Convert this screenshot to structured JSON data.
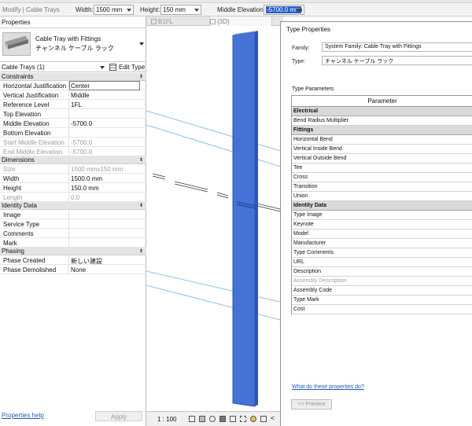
{
  "options_bar": {
    "mode": "Modify | Cable Trays",
    "width_label": "Width:",
    "width_value": "1500 mm",
    "height_label": "Height:",
    "height_value": "150 mm",
    "elevation_label": "Middle Elevation:",
    "elevation_value": "-5700.0 mm"
  },
  "properties": {
    "title": "Properties",
    "family": "Cable Tray with Fittings",
    "type": "チャンネル ケーブル ラック",
    "category": "Cable Trays (1)",
    "edit_type": "Edit Type",
    "groups": [
      {
        "name": "Constraints",
        "rows": [
          {
            "name": "Horizontal Justification",
            "value": "Center",
            "state": "edit"
          },
          {
            "name": "Vertical Justification",
            "value": "Middle",
            "state": ""
          },
          {
            "name": "Reference Level",
            "value": "1FL",
            "state": ""
          },
          {
            "name": "Top Elevation",
            "value": "",
            "state": ""
          },
          {
            "name": "Middle Elevation",
            "value": "-5700.0",
            "state": ""
          },
          {
            "name": "Bottom Elevation",
            "value": "",
            "state": ""
          },
          {
            "name": "Start Middle Elevation",
            "value": "-5700.0",
            "state": "dis"
          },
          {
            "name": "End Middle Elevation",
            "value": "-5700.0",
            "state": "dis"
          }
        ]
      },
      {
        "name": "Dimensions",
        "rows": [
          {
            "name": "Size",
            "value": "1500 mmx150 mm",
            "state": "dis"
          },
          {
            "name": "Width",
            "value": "1500.0 mm",
            "state": ""
          },
          {
            "name": "Height",
            "value": "150.0 mm",
            "state": ""
          },
          {
            "name": "Length",
            "value": "0.0",
            "state": "dis"
          }
        ]
      },
      {
        "name": "Identity Data",
        "rows": [
          {
            "name": "Image",
            "value": "",
            "state": ""
          },
          {
            "name": "Service Type",
            "value": "",
            "state": ""
          },
          {
            "name": "Comments",
            "value": "",
            "state": ""
          },
          {
            "name": "Mark",
            "value": "",
            "state": ""
          }
        ]
      },
      {
        "name": "Phasing",
        "rows": [
          {
            "name": "Phase Created",
            "value": "新しい建設",
            "state": ""
          },
          {
            "name": "Phase Demolished",
            "value": "None",
            "state": ""
          }
        ]
      }
    ],
    "help_link": "Properties help",
    "apply": "Apply"
  },
  "tabs": [
    {
      "label": "B1FL"
    },
    {
      "label": "{3D}"
    }
  ],
  "view_control": {
    "scale": "1 : 100"
  },
  "dialog": {
    "title": "Type Properties",
    "family_label": "Family:",
    "family_value": "System Family: Cable Tray with Fittings",
    "type_label": "Type:",
    "type_value": "チャンネル ケーブル ラック",
    "type_parameters": "Type Parameters",
    "column_header": "Parameter",
    "groups": [
      {
        "name": "Electrical",
        "rows": [
          {
            "name": "Bend Radius Multiplier",
            "state": ""
          }
        ]
      },
      {
        "name": "Fittings",
        "rows": [
          {
            "name": "Horizontal Bend",
            "state": ""
          },
          {
            "name": "Vertical Inside Bend",
            "state": ""
          },
          {
            "name": "Vertical Outside Bend",
            "state": ""
          },
          {
            "name": "Tee",
            "state": ""
          },
          {
            "name": "Cross",
            "state": ""
          },
          {
            "name": "Transition",
            "state": ""
          },
          {
            "name": "Union",
            "state": ""
          }
        ]
      },
      {
        "name": "Identity Data",
        "rows": [
          {
            "name": "Type Image",
            "state": ""
          },
          {
            "name": "Keynote",
            "state": ""
          },
          {
            "name": "Model",
            "state": ""
          },
          {
            "name": "Manufacturer",
            "state": ""
          },
          {
            "name": "Type Comments",
            "state": ""
          },
          {
            "name": "URL",
            "state": ""
          },
          {
            "name": "Description",
            "state": ""
          },
          {
            "name": "Assembly Description",
            "state": "dis"
          },
          {
            "name": "Assembly Code",
            "state": ""
          },
          {
            "name": "Type Mark",
            "state": ""
          },
          {
            "name": "Cost",
            "state": ""
          }
        ]
      }
    ],
    "help_link": "What do these properties do?",
    "preview_button": "<< Preview"
  },
  "colors": {
    "tray_fill": "#4472d6",
    "tray_edge": "#2e56b8",
    "link": "#1f5bb5",
    "selection": "#2b5fc7"
  }
}
